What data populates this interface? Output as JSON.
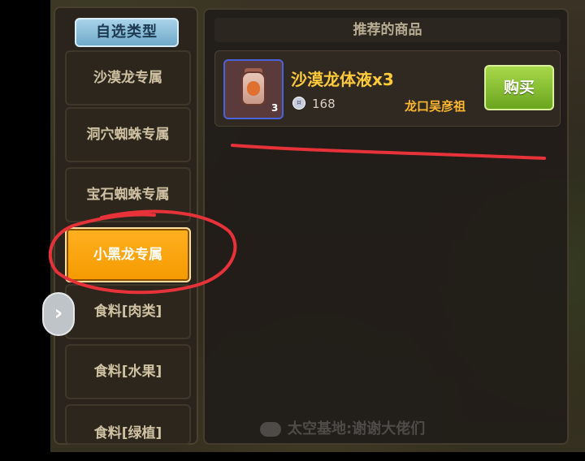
{
  "sidebar": {
    "header": "自选类型",
    "categories": [
      {
        "label": "沙漠龙专属",
        "active": false
      },
      {
        "label": "洞穴蜘蛛专属",
        "active": false
      },
      {
        "label": "宝石蜘蛛专属",
        "active": false
      },
      {
        "label": "小黑龙专属",
        "active": true
      },
      {
        "label": "食料[肉类]",
        "active": false
      },
      {
        "label": "食料[水果]",
        "active": false
      },
      {
        "label": "食料[绿植]",
        "active": false
      }
    ]
  },
  "main": {
    "header": "推荐的商品",
    "product": {
      "name": "沙漠龙体液x3",
      "quantity_badge": "3",
      "price": "168",
      "seller": "龙口吴彦祖",
      "buy_label": "购买"
    }
  },
  "watermark": "太空基地:谢谢大佬们",
  "annotation_color": "#e8323a",
  "colors": {
    "active_category": "#f59a00",
    "buy_button": "#8cc63a",
    "product_name": "#ffca3a"
  }
}
